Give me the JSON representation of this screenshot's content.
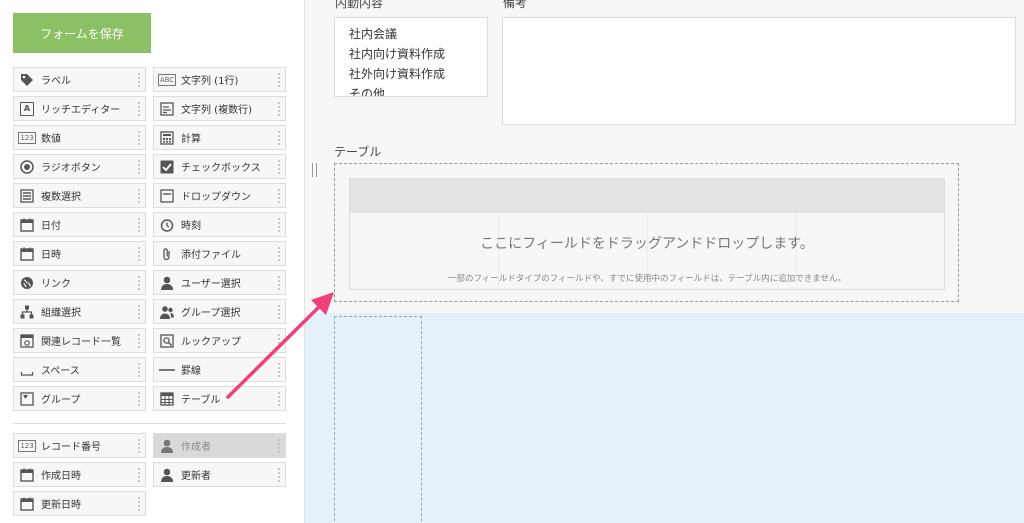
{
  "palette": {
    "save_label": "フォームを保存",
    "items": [
      {
        "label": "ラベル",
        "icon": "tag-icon"
      },
      {
        "label": "文字列 (1行)",
        "icon": "text-single-icon"
      },
      {
        "label": "リッチエディター",
        "icon": "rich-editor-icon"
      },
      {
        "label": "文字列 (複数行)",
        "icon": "text-multi-icon"
      },
      {
        "label": "数値",
        "icon": "number-icon"
      },
      {
        "label": "計算",
        "icon": "calculator-icon"
      },
      {
        "label": "ラジオボタン",
        "icon": "radio-icon"
      },
      {
        "label": "チェックボックス",
        "icon": "checkbox-icon"
      },
      {
        "label": "複数選択",
        "icon": "multi-select-icon"
      },
      {
        "label": "ドロップダウン",
        "icon": "dropdown-icon"
      },
      {
        "label": "日付",
        "icon": "calendar-icon"
      },
      {
        "label": "時刻",
        "icon": "clock-icon"
      },
      {
        "label": "日時",
        "icon": "datetime-icon"
      },
      {
        "label": "添付ファイル",
        "icon": "paperclip-icon"
      },
      {
        "label": "リンク",
        "icon": "globe-icon"
      },
      {
        "label": "ユーザー選択",
        "icon": "user-icon"
      },
      {
        "label": "組織選択",
        "icon": "org-icon"
      },
      {
        "label": "グループ選択",
        "icon": "group-icon"
      },
      {
        "label": "関連レコード一覧",
        "icon": "related-records-icon"
      },
      {
        "label": "ルックアップ",
        "icon": "lookup-icon"
      },
      {
        "label": "スペース",
        "icon": "space-icon"
      },
      {
        "label": "罫線",
        "icon": "line-icon"
      },
      {
        "label": "グループ",
        "icon": "group-field-icon"
      },
      {
        "label": "テーブル",
        "icon": "table-icon"
      }
    ],
    "system_items": [
      {
        "label": "レコード番号",
        "icon": "record-number-icon"
      },
      {
        "label": "作成者",
        "icon": "user-icon"
      },
      {
        "label": "作成日時",
        "icon": "calendar-icon"
      },
      {
        "label": "更新者",
        "icon": "user-icon"
      },
      {
        "label": "更新日時",
        "icon": "calendar-icon"
      }
    ],
    "icon_text": {
      "abc": "ABC",
      "num": "123",
      "rich": "A"
    }
  },
  "form": {
    "content_label": "内勤内容",
    "memo_label": "備考",
    "checklist": [
      "社内会議",
      "社内向け資料作成",
      "社外向け資料作成",
      "その他"
    ],
    "table_label": "テーブル",
    "drop_message": "ここにフィールドをドラッグアンドドロップします。",
    "drop_note": "一部のフィールドタイプのフィールドや、すでに使用中のフィールドは、テーブル内に追加できません。"
  },
  "colors": {
    "save_button": "#8bc164",
    "arrow": "#f0407a",
    "drop_zone": "#e4f1fb"
  }
}
